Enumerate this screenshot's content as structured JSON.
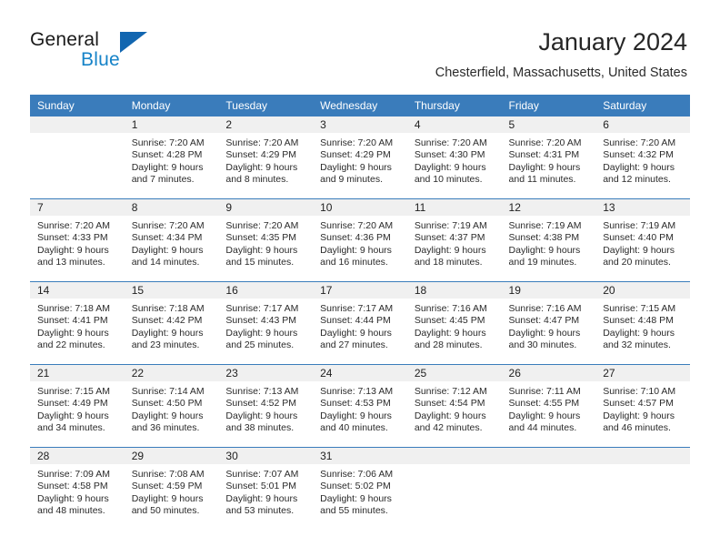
{
  "logo": {
    "word_one": "General",
    "word_two": "Blue",
    "triangle_color": "#1266b0",
    "blue_text_color": "#1683c8"
  },
  "header": {
    "month_title": "January 2024",
    "location": "Chesterfield, Massachusetts, United States",
    "header_bg_color": "#3a7cbb",
    "daynum_bg_color": "#f0f0f0"
  },
  "weekdays": [
    "Sunday",
    "Monday",
    "Tuesday",
    "Wednesday",
    "Thursday",
    "Friday",
    "Saturday"
  ],
  "weeks": [
    [
      {
        "day": "",
        "sunrise": "",
        "sunset": "",
        "daylight_line1": "",
        "daylight_line2": ""
      },
      {
        "day": "1",
        "sunrise": "Sunrise: 7:20 AM",
        "sunset": "Sunset: 4:28 PM",
        "daylight_line1": "Daylight: 9 hours",
        "daylight_line2": "and 7 minutes."
      },
      {
        "day": "2",
        "sunrise": "Sunrise: 7:20 AM",
        "sunset": "Sunset: 4:29 PM",
        "daylight_line1": "Daylight: 9 hours",
        "daylight_line2": "and 8 minutes."
      },
      {
        "day": "3",
        "sunrise": "Sunrise: 7:20 AM",
        "sunset": "Sunset: 4:29 PM",
        "daylight_line1": "Daylight: 9 hours",
        "daylight_line2": "and 9 minutes."
      },
      {
        "day": "4",
        "sunrise": "Sunrise: 7:20 AM",
        "sunset": "Sunset: 4:30 PM",
        "daylight_line1": "Daylight: 9 hours",
        "daylight_line2": "and 10 minutes."
      },
      {
        "day": "5",
        "sunrise": "Sunrise: 7:20 AM",
        "sunset": "Sunset: 4:31 PM",
        "daylight_line1": "Daylight: 9 hours",
        "daylight_line2": "and 11 minutes."
      },
      {
        "day": "6",
        "sunrise": "Sunrise: 7:20 AM",
        "sunset": "Sunset: 4:32 PM",
        "daylight_line1": "Daylight: 9 hours",
        "daylight_line2": "and 12 minutes."
      }
    ],
    [
      {
        "day": "7",
        "sunrise": "Sunrise: 7:20 AM",
        "sunset": "Sunset: 4:33 PM",
        "daylight_line1": "Daylight: 9 hours",
        "daylight_line2": "and 13 minutes."
      },
      {
        "day": "8",
        "sunrise": "Sunrise: 7:20 AM",
        "sunset": "Sunset: 4:34 PM",
        "daylight_line1": "Daylight: 9 hours",
        "daylight_line2": "and 14 minutes."
      },
      {
        "day": "9",
        "sunrise": "Sunrise: 7:20 AM",
        "sunset": "Sunset: 4:35 PM",
        "daylight_line1": "Daylight: 9 hours",
        "daylight_line2": "and 15 minutes."
      },
      {
        "day": "10",
        "sunrise": "Sunrise: 7:20 AM",
        "sunset": "Sunset: 4:36 PM",
        "daylight_line1": "Daylight: 9 hours",
        "daylight_line2": "and 16 minutes."
      },
      {
        "day": "11",
        "sunrise": "Sunrise: 7:19 AM",
        "sunset": "Sunset: 4:37 PM",
        "daylight_line1": "Daylight: 9 hours",
        "daylight_line2": "and 18 minutes."
      },
      {
        "day": "12",
        "sunrise": "Sunrise: 7:19 AM",
        "sunset": "Sunset: 4:38 PM",
        "daylight_line1": "Daylight: 9 hours",
        "daylight_line2": "and 19 minutes."
      },
      {
        "day": "13",
        "sunrise": "Sunrise: 7:19 AM",
        "sunset": "Sunset: 4:40 PM",
        "daylight_line1": "Daylight: 9 hours",
        "daylight_line2": "and 20 minutes."
      }
    ],
    [
      {
        "day": "14",
        "sunrise": "Sunrise: 7:18 AM",
        "sunset": "Sunset: 4:41 PM",
        "daylight_line1": "Daylight: 9 hours",
        "daylight_line2": "and 22 minutes."
      },
      {
        "day": "15",
        "sunrise": "Sunrise: 7:18 AM",
        "sunset": "Sunset: 4:42 PM",
        "daylight_line1": "Daylight: 9 hours",
        "daylight_line2": "and 23 minutes."
      },
      {
        "day": "16",
        "sunrise": "Sunrise: 7:17 AM",
        "sunset": "Sunset: 4:43 PM",
        "daylight_line1": "Daylight: 9 hours",
        "daylight_line2": "and 25 minutes."
      },
      {
        "day": "17",
        "sunrise": "Sunrise: 7:17 AM",
        "sunset": "Sunset: 4:44 PM",
        "daylight_line1": "Daylight: 9 hours",
        "daylight_line2": "and 27 minutes."
      },
      {
        "day": "18",
        "sunrise": "Sunrise: 7:16 AM",
        "sunset": "Sunset: 4:45 PM",
        "daylight_line1": "Daylight: 9 hours",
        "daylight_line2": "and 28 minutes."
      },
      {
        "day": "19",
        "sunrise": "Sunrise: 7:16 AM",
        "sunset": "Sunset: 4:47 PM",
        "daylight_line1": "Daylight: 9 hours",
        "daylight_line2": "and 30 minutes."
      },
      {
        "day": "20",
        "sunrise": "Sunrise: 7:15 AM",
        "sunset": "Sunset: 4:48 PM",
        "daylight_line1": "Daylight: 9 hours",
        "daylight_line2": "and 32 minutes."
      }
    ],
    [
      {
        "day": "21",
        "sunrise": "Sunrise: 7:15 AM",
        "sunset": "Sunset: 4:49 PM",
        "daylight_line1": "Daylight: 9 hours",
        "daylight_line2": "and 34 minutes."
      },
      {
        "day": "22",
        "sunrise": "Sunrise: 7:14 AM",
        "sunset": "Sunset: 4:50 PM",
        "daylight_line1": "Daylight: 9 hours",
        "daylight_line2": "and 36 minutes."
      },
      {
        "day": "23",
        "sunrise": "Sunrise: 7:13 AM",
        "sunset": "Sunset: 4:52 PM",
        "daylight_line1": "Daylight: 9 hours",
        "daylight_line2": "and 38 minutes."
      },
      {
        "day": "24",
        "sunrise": "Sunrise: 7:13 AM",
        "sunset": "Sunset: 4:53 PM",
        "daylight_line1": "Daylight: 9 hours",
        "daylight_line2": "and 40 minutes."
      },
      {
        "day": "25",
        "sunrise": "Sunrise: 7:12 AM",
        "sunset": "Sunset: 4:54 PM",
        "daylight_line1": "Daylight: 9 hours",
        "daylight_line2": "and 42 minutes."
      },
      {
        "day": "26",
        "sunrise": "Sunrise: 7:11 AM",
        "sunset": "Sunset: 4:55 PM",
        "daylight_line1": "Daylight: 9 hours",
        "daylight_line2": "and 44 minutes."
      },
      {
        "day": "27",
        "sunrise": "Sunrise: 7:10 AM",
        "sunset": "Sunset: 4:57 PM",
        "daylight_line1": "Daylight: 9 hours",
        "daylight_line2": "and 46 minutes."
      }
    ],
    [
      {
        "day": "28",
        "sunrise": "Sunrise: 7:09 AM",
        "sunset": "Sunset: 4:58 PM",
        "daylight_line1": "Daylight: 9 hours",
        "daylight_line2": "and 48 minutes."
      },
      {
        "day": "29",
        "sunrise": "Sunrise: 7:08 AM",
        "sunset": "Sunset: 4:59 PM",
        "daylight_line1": "Daylight: 9 hours",
        "daylight_line2": "and 50 minutes."
      },
      {
        "day": "30",
        "sunrise": "Sunrise: 7:07 AM",
        "sunset": "Sunset: 5:01 PM",
        "daylight_line1": "Daylight: 9 hours",
        "daylight_line2": "and 53 minutes."
      },
      {
        "day": "31",
        "sunrise": "Sunrise: 7:06 AM",
        "sunset": "Sunset: 5:02 PM",
        "daylight_line1": "Daylight: 9 hours",
        "daylight_line2": "and 55 minutes."
      },
      {
        "day": "",
        "sunrise": "",
        "sunset": "",
        "daylight_line1": "",
        "daylight_line2": ""
      },
      {
        "day": "",
        "sunrise": "",
        "sunset": "",
        "daylight_line1": "",
        "daylight_line2": ""
      },
      {
        "day": "",
        "sunrise": "",
        "sunset": "",
        "daylight_line1": "",
        "daylight_line2": ""
      }
    ]
  ]
}
